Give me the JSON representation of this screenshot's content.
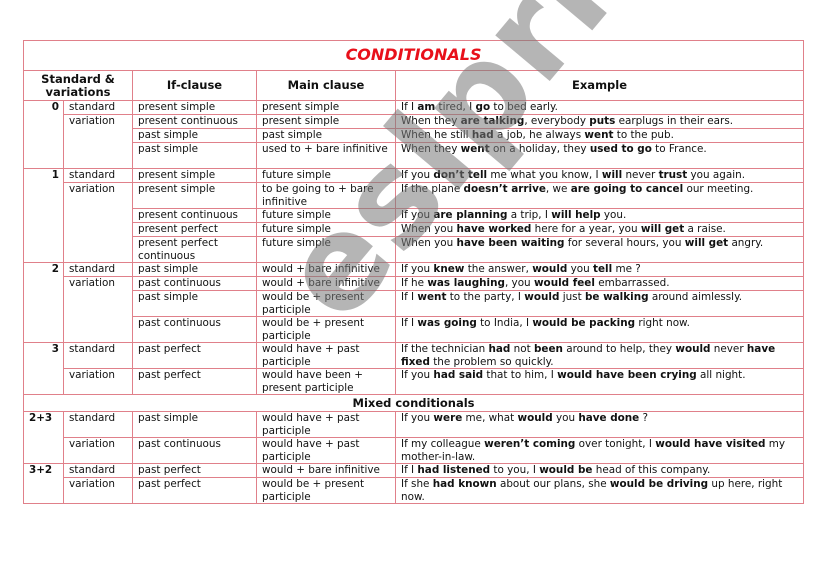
{
  "title": "CONDITIONALS",
  "colors": {
    "title": "#e8101a",
    "border": "#e0808a",
    "watermark": "#808080"
  },
  "headers": {
    "standard_variations": "Standard & variations",
    "if_clause": "If-clause",
    "main_clause": "Main clause",
    "example": "Example"
  },
  "groups": [
    {
      "number": "0",
      "rows": [
        {
          "type": "standard",
          "if_clause": "present simple",
          "main_clause": "present simple",
          "example": [
            [
              "If I ",
              false
            ],
            [
              "am",
              true
            ],
            [
              " tired, I ",
              false
            ],
            [
              "go",
              true
            ],
            [
              " to bed early.",
              false
            ]
          ]
        },
        {
          "type": "variation",
          "if_clause": "present continuous",
          "main_clause": "present simple",
          "example": [
            [
              "When they ",
              false
            ],
            [
              "are talking",
              true
            ],
            [
              ", everybody ",
              false
            ],
            [
              "puts",
              true
            ],
            [
              " earplugs in their ears.",
              false
            ]
          ]
        },
        {
          "type": "",
          "if_clause": "past simple",
          "main_clause": "past simple",
          "example": [
            [
              "When he still ",
              false
            ],
            [
              "had",
              true
            ],
            [
              " a job, he always ",
              false
            ],
            [
              "went",
              true
            ],
            [
              " to the pub.",
              false
            ]
          ]
        },
        {
          "type": "",
          "if_clause": "past simple",
          "main_clause": "used to + bare infinitive",
          "example": [
            [
              "When they ",
              false
            ],
            [
              "went",
              true
            ],
            [
              " on a holiday, they ",
              false
            ],
            [
              "used to go",
              true
            ],
            [
              " to France.",
              false
            ]
          ]
        }
      ]
    },
    {
      "number": "1",
      "rows": [
        {
          "type": "standard",
          "if_clause": "present simple",
          "main_clause": "future simple",
          "example": [
            [
              "If you ",
              false
            ],
            [
              "don’t tell",
              true
            ],
            [
              " me what you know, I ",
              false
            ],
            [
              "will",
              true
            ],
            [
              " never ",
              false
            ],
            [
              "trust",
              true
            ],
            [
              " you again.",
              false
            ]
          ]
        },
        {
          "type": "variation",
          "if_clause": "present simple",
          "main_clause": "to be going to + bare infinitive",
          "example": [
            [
              "If the plane ",
              false
            ],
            [
              "doesn’t arrive",
              true
            ],
            [
              ", we ",
              false
            ],
            [
              "are going to cancel",
              true
            ],
            [
              " our meeting.",
              false
            ]
          ]
        },
        {
          "type": "",
          "if_clause": "present continuous",
          "main_clause": "future simple",
          "example": [
            [
              "If you ",
              false
            ],
            [
              "are planning",
              true
            ],
            [
              " a trip, I ",
              false
            ],
            [
              "will help",
              true
            ],
            [
              " you.",
              false
            ]
          ]
        },
        {
          "type": "",
          "if_clause": "present perfect",
          "main_clause": "future simple",
          "example": [
            [
              "When you ",
              false
            ],
            [
              "have worked",
              true
            ],
            [
              " here for a year, you ",
              false
            ],
            [
              "will get",
              true
            ],
            [
              " a raise.",
              false
            ]
          ]
        },
        {
          "type": "",
          "if_clause": "present perfect continuous",
          "main_clause": "future simple",
          "example": [
            [
              "When you ",
              false
            ],
            [
              "have been waiting",
              true
            ],
            [
              " for several hours, you ",
              false
            ],
            [
              "will get",
              true
            ],
            [
              " angry.",
              false
            ]
          ]
        }
      ]
    },
    {
      "number": "2",
      "rows": [
        {
          "type": "standard",
          "if_clause": "past simple",
          "main_clause": "would + bare infinitive",
          "example": [
            [
              "If you ",
              false
            ],
            [
              "knew",
              true
            ],
            [
              " the answer, ",
              false
            ],
            [
              "would",
              true
            ],
            [
              " you ",
              false
            ],
            [
              "tell",
              true
            ],
            [
              " me ?",
              false
            ]
          ]
        },
        {
          "type": "variation",
          "if_clause": "past continuous",
          "main_clause": "would + bare infinitive",
          "example": [
            [
              "If he ",
              false
            ],
            [
              "was laughing",
              true
            ],
            [
              ", you ",
              false
            ],
            [
              "would feel",
              true
            ],
            [
              " embarrassed.",
              false
            ]
          ]
        },
        {
          "type": "",
          "if_clause": "past simple",
          "main_clause": "would be + present participle",
          "example": [
            [
              "If I ",
              false
            ],
            [
              "went",
              true
            ],
            [
              " to the party, I ",
              false
            ],
            [
              "would",
              true
            ],
            [
              " just ",
              false
            ],
            [
              "be walking",
              true
            ],
            [
              " around aimlessly.",
              false
            ]
          ]
        },
        {
          "type": "",
          "if_clause": "past continuous",
          "main_clause": "would be + present participle",
          "example": [
            [
              "If I ",
              false
            ],
            [
              "was going",
              true
            ],
            [
              " to India, I ",
              false
            ],
            [
              "would be packing",
              true
            ],
            [
              " right now.",
              false
            ]
          ]
        }
      ]
    },
    {
      "number": "3",
      "rows": [
        {
          "type": "standard",
          "if_clause": "past perfect",
          "main_clause": "would have + past participle",
          "example": [
            [
              "If the technician ",
              false
            ],
            [
              "had",
              true
            ],
            [
              " not ",
              false
            ],
            [
              "been",
              true
            ],
            [
              " around to help, they ",
              false
            ],
            [
              "would",
              true
            ],
            [
              " never ",
              false
            ],
            [
              "have fixed",
              true
            ],
            [
              " the problem so quickly.",
              false
            ]
          ]
        },
        {
          "type": "variation",
          "if_clause": "past perfect",
          "main_clause": "would have been + present participle",
          "example": [
            [
              "If you ",
              false
            ],
            [
              "had said",
              true
            ],
            [
              " that to him, I ",
              false
            ],
            [
              "would have been crying",
              true
            ],
            [
              " all night.",
              false
            ]
          ]
        }
      ]
    }
  ],
  "mixed_heading": "Mixed conditionals",
  "mixed_groups": [
    {
      "number": "2+3",
      "rows": [
        {
          "type": "standard",
          "if_clause": "past simple",
          "main_clause": "would have + past participle",
          "example": [
            [
              "If you ",
              false
            ],
            [
              "were",
              true
            ],
            [
              " me, what ",
              false
            ],
            [
              "would",
              true
            ],
            [
              " you ",
              false
            ],
            [
              "have done",
              true
            ],
            [
              " ?",
              false
            ]
          ]
        },
        {
          "type": "variation",
          "if_clause": "past continuous",
          "main_clause": "would have + past participle",
          "example": [
            [
              "If my colleague ",
              false
            ],
            [
              "weren’t coming",
              true
            ],
            [
              " over tonight, I ",
              false
            ],
            [
              "would have visited",
              true
            ],
            [
              " my mother-in-law.",
              false
            ]
          ]
        }
      ]
    },
    {
      "number": "3+2",
      "rows": [
        {
          "type": "standard",
          "if_clause": "past perfect",
          "main_clause": "would + bare infinitive",
          "example": [
            [
              "If I ",
              false
            ],
            [
              "had listened",
              true
            ],
            [
              " to you, I ",
              false
            ],
            [
              "would be",
              true
            ],
            [
              " head of this company.",
              false
            ]
          ]
        },
        {
          "type": "variation",
          "if_clause": "past perfect",
          "main_clause": "would be + present participle",
          "example": [
            [
              "If she ",
              false
            ],
            [
              "had known",
              true
            ],
            [
              " about our plans, she ",
              false
            ],
            [
              "would be driving",
              true
            ],
            [
              " up here, right now.",
              false
            ]
          ]
        }
      ]
    }
  ],
  "watermark": "eslprintables.com"
}
